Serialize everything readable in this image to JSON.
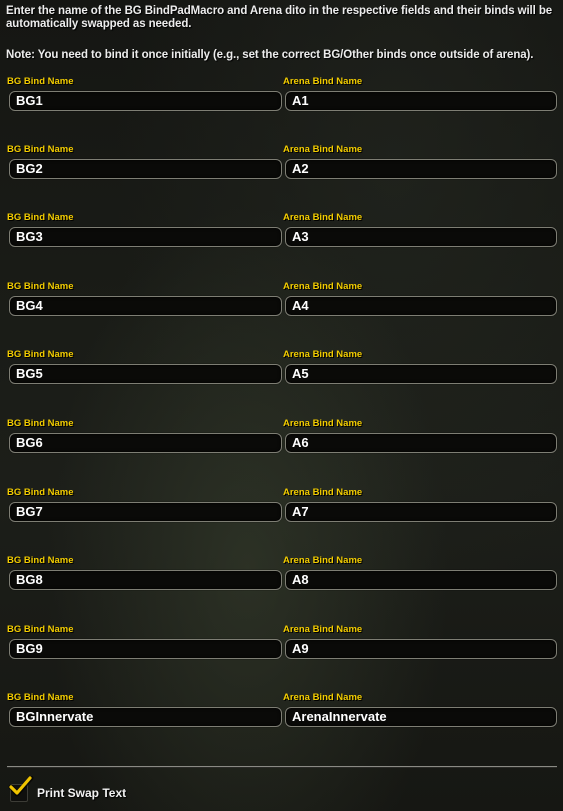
{
  "description": {
    "line1": "Enter the name of the BG BindPadMacro and Arena dito in the respective fields and their binds will be automatically swapped as needed.",
    "note": "Note: You need to bind it once initially (e.g., set the correct BG/Other binds once outside of arena)."
  },
  "bind_rows": [
    {
      "bg_label": "BG Bind Name",
      "bg_value": "BG1",
      "arena_label": "Arena Bind Name",
      "arena_value": "A1"
    },
    {
      "bg_label": "BG Bind Name",
      "bg_value": "BG2",
      "arena_label": "Arena Bind Name",
      "arena_value": "A2"
    },
    {
      "bg_label": "BG Bind Name",
      "bg_value": "BG3",
      "arena_label": "Arena Bind Name",
      "arena_value": "A3"
    },
    {
      "bg_label": "BG Bind Name",
      "bg_value": "BG4",
      "arena_label": "Arena Bind Name",
      "arena_value": "A4"
    },
    {
      "bg_label": "BG Bind Name",
      "bg_value": "BG5",
      "arena_label": "Arena Bind Name",
      "arena_value": "A5"
    },
    {
      "bg_label": "BG Bind Name",
      "bg_value": "BG6",
      "arena_label": "Arena Bind Name",
      "arena_value": "A6"
    },
    {
      "bg_label": "BG Bind Name",
      "bg_value": "BG7",
      "arena_label": "Arena Bind Name",
      "arena_value": "A7"
    },
    {
      "bg_label": "BG Bind Name",
      "bg_value": "BG8",
      "arena_label": "Arena Bind Name",
      "arena_value": "A8"
    },
    {
      "bg_label": "BG Bind Name",
      "bg_value": "BG9",
      "arena_label": "Arena Bind Name",
      "arena_value": "A9"
    },
    {
      "bg_label": "BG Bind Name",
      "bg_value": "BGInnervate",
      "arena_label": "Arena Bind Name",
      "arena_value": "ArenaInnervate"
    }
  ],
  "print_swap": {
    "label": "Print Swap Text",
    "checked": true,
    "icon": "checkmark-icon"
  },
  "colors": {
    "label_gold": "#f2cc00",
    "text_white": "#ffffff",
    "checkmark_gold": "#f0c400"
  }
}
